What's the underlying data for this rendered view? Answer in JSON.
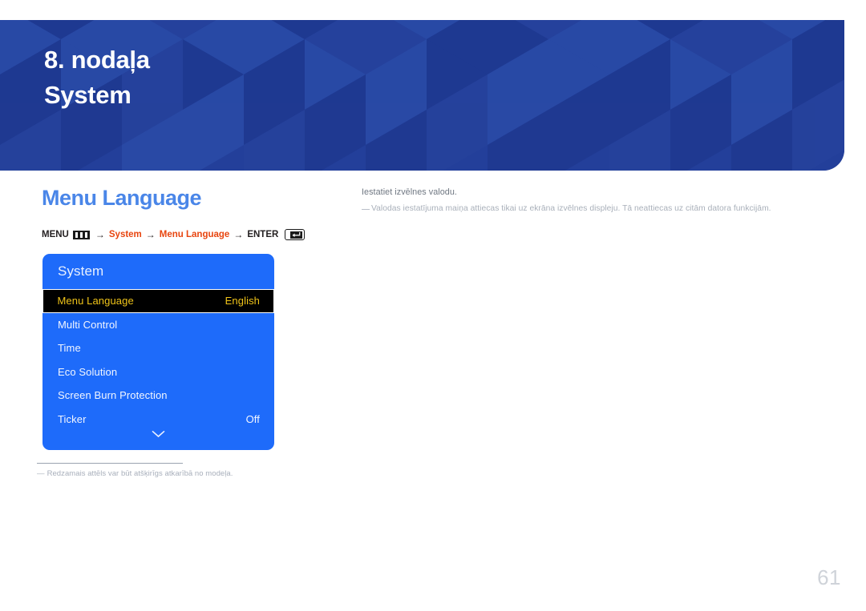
{
  "banner": {
    "chapter": "8. nodaļa",
    "chapter_title": "System",
    "bg_color": "#233f9a"
  },
  "section": {
    "title": "Menu Language",
    "title_color": "#4a86e8"
  },
  "breadcrumb": {
    "menu_label": "MENU",
    "menu_icon": "menu-bars-icon",
    "arrow1": "→",
    "crumb1": "System",
    "arrow2": "→",
    "crumb2": "Menu Language",
    "arrow3": "→",
    "enter_label": "ENTER",
    "enter_icon": "enter-return-icon",
    "highlight_color": "#e8450f"
  },
  "osd": {
    "title": "System",
    "bg_color": "#1e6bfa",
    "selected_text_color": "#f0c419",
    "items": [
      {
        "label": "Menu Language",
        "value": "English",
        "selected": true
      },
      {
        "label": "Multi Control",
        "value": "",
        "selected": false
      },
      {
        "label": "Time",
        "value": "",
        "selected": false
      },
      {
        "label": "Eco Solution",
        "value": "",
        "selected": false
      },
      {
        "label": "Screen Burn Protection",
        "value": "",
        "selected": false
      },
      {
        "label": "Ticker",
        "value": "Off",
        "selected": false
      }
    ],
    "scroll_indicator": "chevron-down-icon",
    "footnote_dash": "―",
    "footnote": "Redzamais attēls var būt atšķirīgs atkarībā no modeļa."
  },
  "description": {
    "main": "Iestatiet izvēlnes valodu.",
    "note": "Valodas iestatījuma maiņa attiecas tikai uz ekrāna izvēlnes displeju. Tā neattiecas uz citām datora funkcijām."
  },
  "footer": {
    "page_number": "61"
  }
}
